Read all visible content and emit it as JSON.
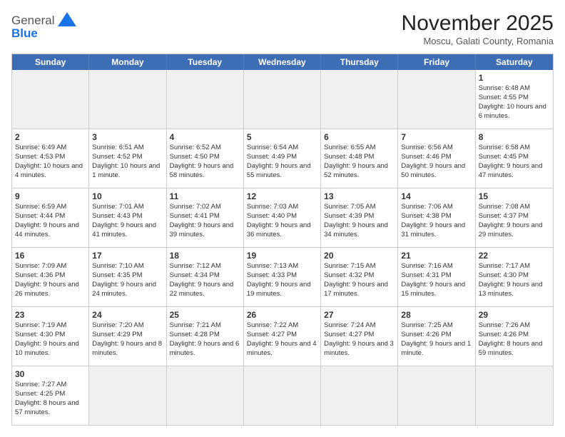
{
  "header": {
    "logo_general": "General",
    "logo_blue": "Blue",
    "title": "November 2025",
    "location": "Moscu, Galati County, Romania"
  },
  "days_of_week": [
    "Sunday",
    "Monday",
    "Tuesday",
    "Wednesday",
    "Thursday",
    "Friday",
    "Saturday"
  ],
  "weeks": [
    [
      {
        "num": "",
        "info": "",
        "shaded": true
      },
      {
        "num": "",
        "info": "",
        "shaded": true
      },
      {
        "num": "",
        "info": "",
        "shaded": true
      },
      {
        "num": "",
        "info": "",
        "shaded": true
      },
      {
        "num": "",
        "info": "",
        "shaded": true
      },
      {
        "num": "",
        "info": "",
        "shaded": true
      },
      {
        "num": "1",
        "info": "Sunrise: 6:48 AM\nSunset: 4:55 PM\nDaylight: 10 hours and 6 minutes.",
        "shaded": false
      }
    ],
    [
      {
        "num": "2",
        "info": "Sunrise: 6:49 AM\nSunset: 4:53 PM\nDaylight: 10 hours and 4 minutes.",
        "shaded": false
      },
      {
        "num": "3",
        "info": "Sunrise: 6:51 AM\nSunset: 4:52 PM\nDaylight: 10 hours and 1 minute.",
        "shaded": false
      },
      {
        "num": "4",
        "info": "Sunrise: 6:52 AM\nSunset: 4:50 PM\nDaylight: 9 hours and 58 minutes.",
        "shaded": false
      },
      {
        "num": "5",
        "info": "Sunrise: 6:54 AM\nSunset: 4:49 PM\nDaylight: 9 hours and 55 minutes.",
        "shaded": false
      },
      {
        "num": "6",
        "info": "Sunrise: 6:55 AM\nSunset: 4:48 PM\nDaylight: 9 hours and 52 minutes.",
        "shaded": false
      },
      {
        "num": "7",
        "info": "Sunrise: 6:56 AM\nSunset: 4:46 PM\nDaylight: 9 hours and 50 minutes.",
        "shaded": false
      },
      {
        "num": "8",
        "info": "Sunrise: 6:58 AM\nSunset: 4:45 PM\nDaylight: 9 hours and 47 minutes.",
        "shaded": false
      }
    ],
    [
      {
        "num": "9",
        "info": "Sunrise: 6:59 AM\nSunset: 4:44 PM\nDaylight: 9 hours and 44 minutes.",
        "shaded": false
      },
      {
        "num": "10",
        "info": "Sunrise: 7:01 AM\nSunset: 4:43 PM\nDaylight: 9 hours and 41 minutes.",
        "shaded": false
      },
      {
        "num": "11",
        "info": "Sunrise: 7:02 AM\nSunset: 4:41 PM\nDaylight: 9 hours and 39 minutes.",
        "shaded": false
      },
      {
        "num": "12",
        "info": "Sunrise: 7:03 AM\nSunset: 4:40 PM\nDaylight: 9 hours and 36 minutes.",
        "shaded": false
      },
      {
        "num": "13",
        "info": "Sunrise: 7:05 AM\nSunset: 4:39 PM\nDaylight: 9 hours and 34 minutes.",
        "shaded": false
      },
      {
        "num": "14",
        "info": "Sunrise: 7:06 AM\nSunset: 4:38 PM\nDaylight: 9 hours and 31 minutes.",
        "shaded": false
      },
      {
        "num": "15",
        "info": "Sunrise: 7:08 AM\nSunset: 4:37 PM\nDaylight: 9 hours and 29 minutes.",
        "shaded": false
      }
    ],
    [
      {
        "num": "16",
        "info": "Sunrise: 7:09 AM\nSunset: 4:36 PM\nDaylight: 9 hours and 26 minutes.",
        "shaded": false
      },
      {
        "num": "17",
        "info": "Sunrise: 7:10 AM\nSunset: 4:35 PM\nDaylight: 9 hours and 24 minutes.",
        "shaded": false
      },
      {
        "num": "18",
        "info": "Sunrise: 7:12 AM\nSunset: 4:34 PM\nDaylight: 9 hours and 22 minutes.",
        "shaded": false
      },
      {
        "num": "19",
        "info": "Sunrise: 7:13 AM\nSunset: 4:33 PM\nDaylight: 9 hours and 19 minutes.",
        "shaded": false
      },
      {
        "num": "20",
        "info": "Sunrise: 7:15 AM\nSunset: 4:32 PM\nDaylight: 9 hours and 17 minutes.",
        "shaded": false
      },
      {
        "num": "21",
        "info": "Sunrise: 7:16 AM\nSunset: 4:31 PM\nDaylight: 9 hours and 15 minutes.",
        "shaded": false
      },
      {
        "num": "22",
        "info": "Sunrise: 7:17 AM\nSunset: 4:30 PM\nDaylight: 9 hours and 13 minutes.",
        "shaded": false
      }
    ],
    [
      {
        "num": "23",
        "info": "Sunrise: 7:19 AM\nSunset: 4:30 PM\nDaylight: 9 hours and 10 minutes.",
        "shaded": false
      },
      {
        "num": "24",
        "info": "Sunrise: 7:20 AM\nSunset: 4:29 PM\nDaylight: 9 hours and 8 minutes.",
        "shaded": false
      },
      {
        "num": "25",
        "info": "Sunrise: 7:21 AM\nSunset: 4:28 PM\nDaylight: 9 hours and 6 minutes.",
        "shaded": false
      },
      {
        "num": "26",
        "info": "Sunrise: 7:22 AM\nSunset: 4:27 PM\nDaylight: 9 hours and 4 minutes.",
        "shaded": false
      },
      {
        "num": "27",
        "info": "Sunrise: 7:24 AM\nSunset: 4:27 PM\nDaylight: 9 hours and 3 minutes.",
        "shaded": false
      },
      {
        "num": "28",
        "info": "Sunrise: 7:25 AM\nSunset: 4:26 PM\nDaylight: 9 hours and 1 minute.",
        "shaded": false
      },
      {
        "num": "29",
        "info": "Sunrise: 7:26 AM\nSunset: 4:26 PM\nDaylight: 8 hours and 59 minutes.",
        "shaded": false
      }
    ],
    [
      {
        "num": "30",
        "info": "Sunrise: 7:27 AM\nSunset: 4:25 PM\nDaylight: 8 hours and 57 minutes.",
        "shaded": false
      },
      {
        "num": "",
        "info": "",
        "shaded": true
      },
      {
        "num": "",
        "info": "",
        "shaded": true
      },
      {
        "num": "",
        "info": "",
        "shaded": true
      },
      {
        "num": "",
        "info": "",
        "shaded": true
      },
      {
        "num": "",
        "info": "",
        "shaded": true
      },
      {
        "num": "",
        "info": "",
        "shaded": true
      }
    ]
  ]
}
